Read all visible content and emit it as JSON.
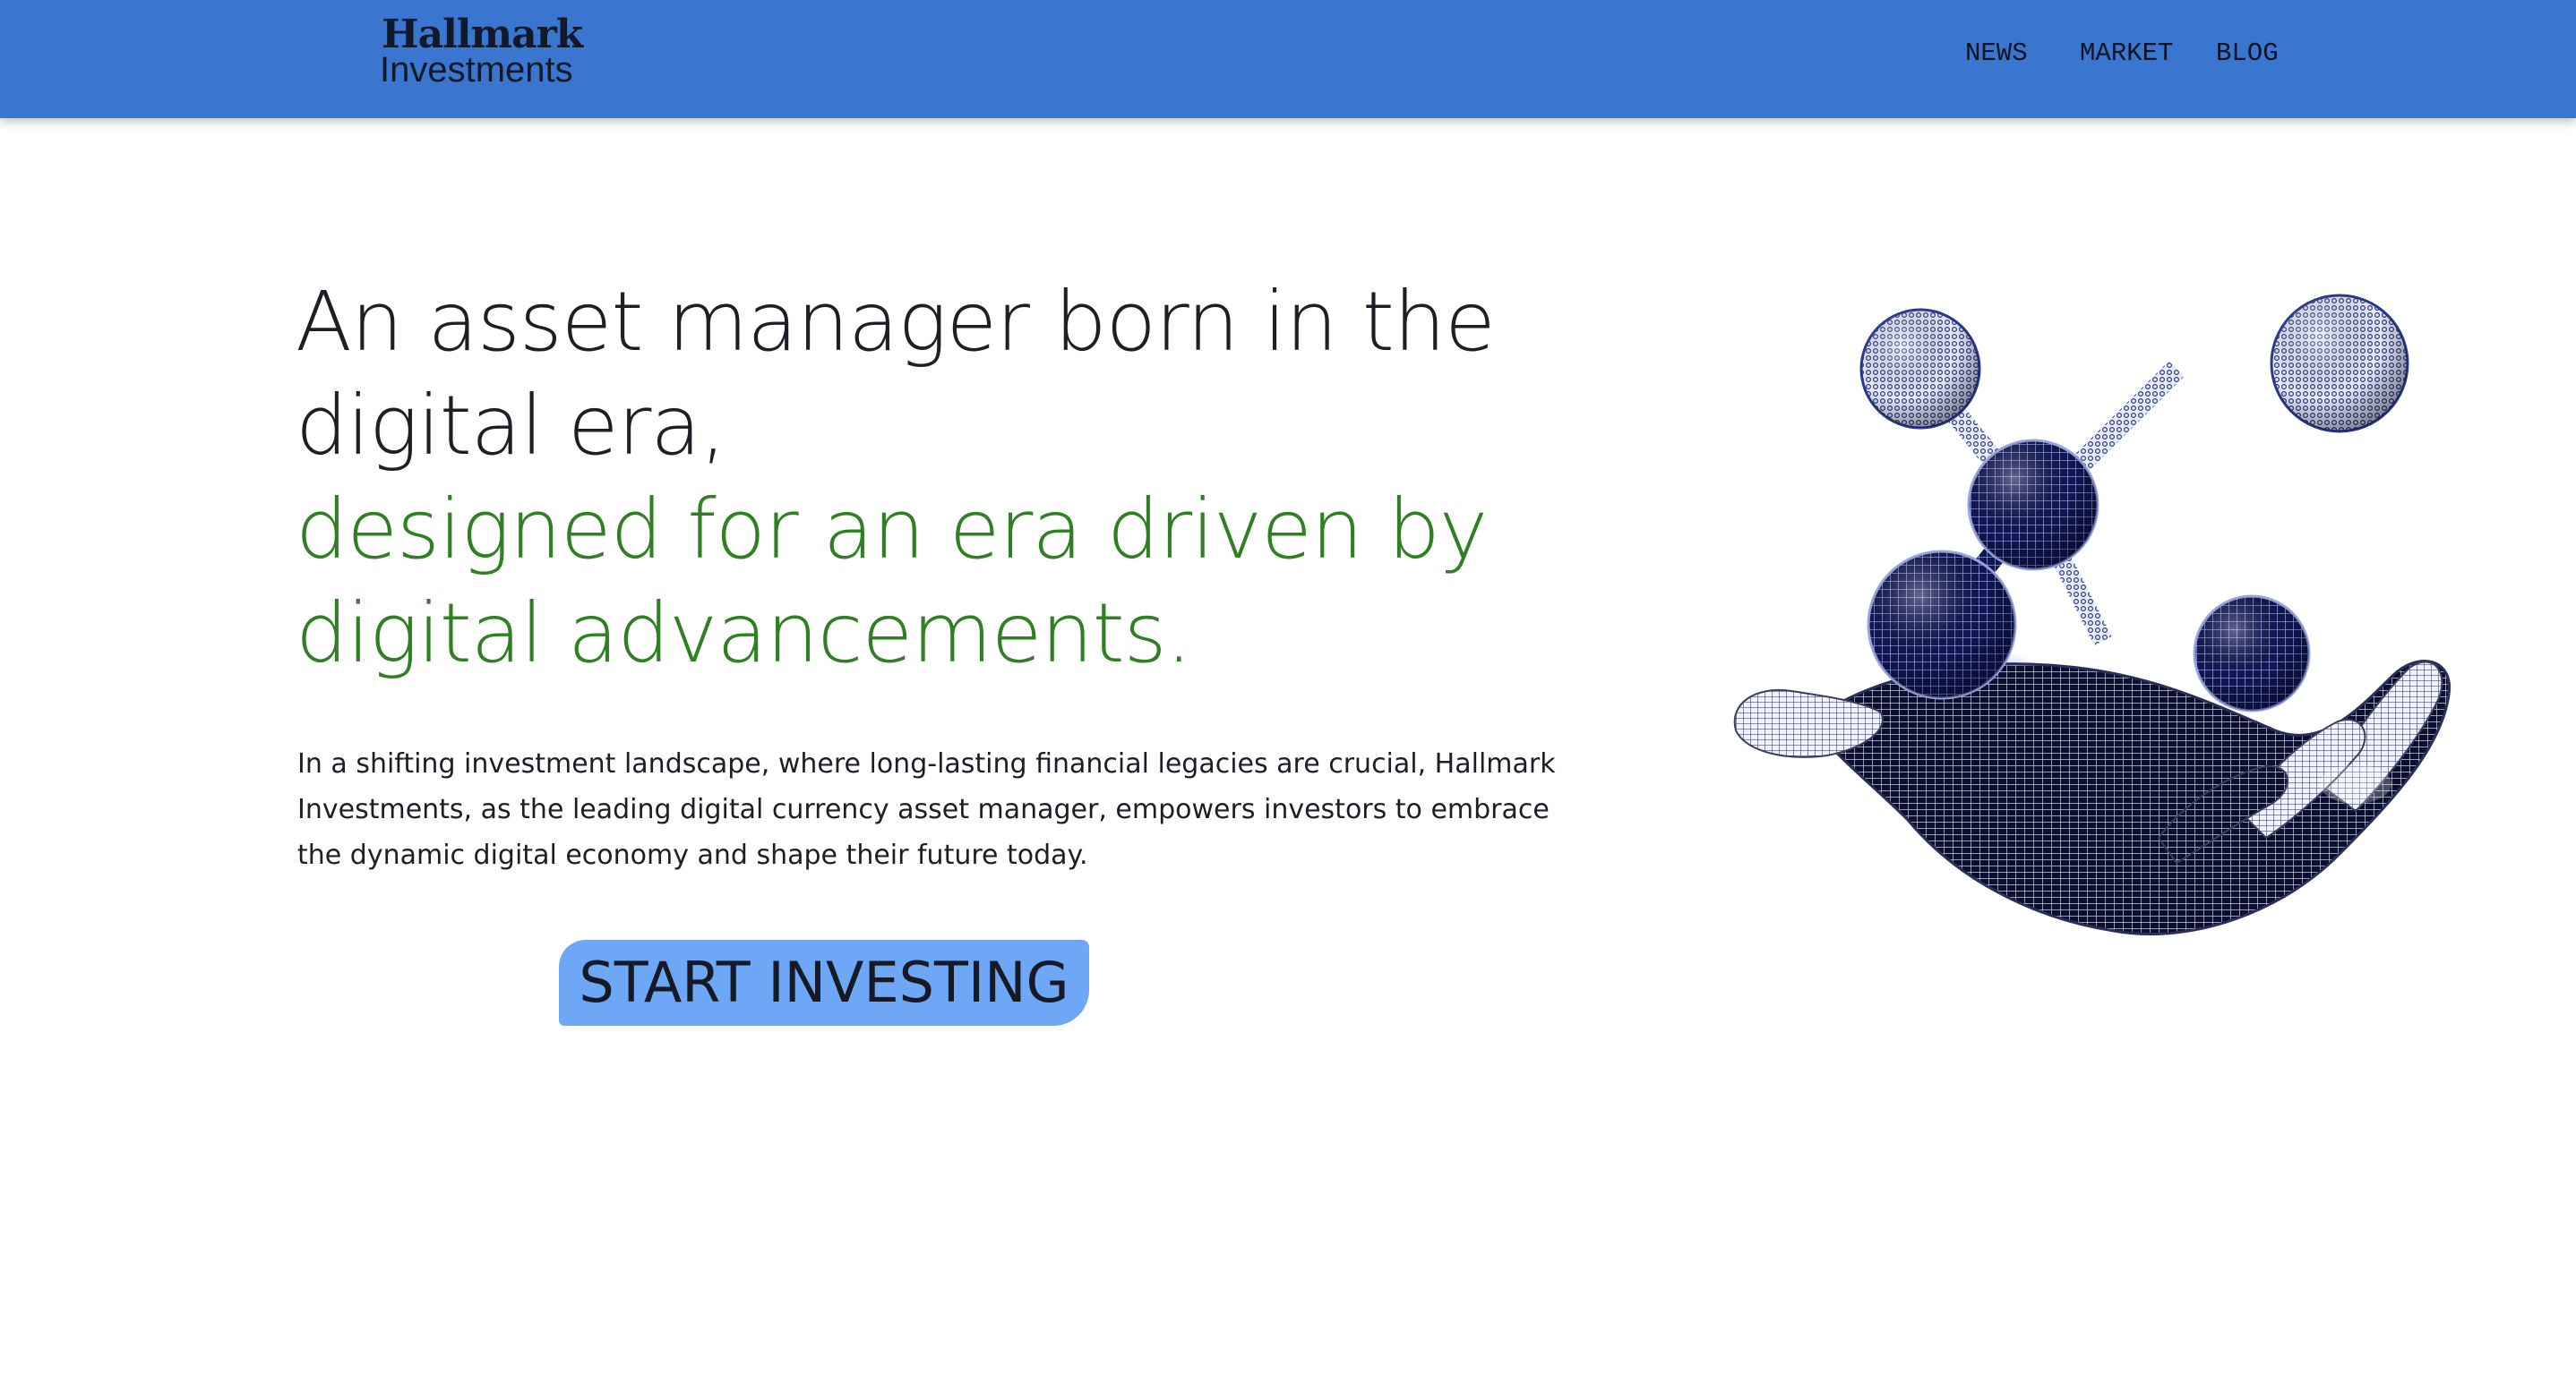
{
  "header": {
    "logo": {
      "line1": "Hallmark",
      "line2": "Investments"
    },
    "nav": [
      {
        "label": "NEWS"
      },
      {
        "label": "MARKET"
      },
      {
        "label": "BLOG"
      }
    ]
  },
  "hero": {
    "headline_lead": "An asset manager born in the digital era,",
    "headline_accent": "designed for an era driven by digital advancements.",
    "intro": "In a shifting investment landscape, where long-lasting financial legacies are crucial, Hallmark Investments, as the leading digital currency asset manager, empowers investors to embrace the dynamic digital economy and shape their future today.",
    "cta_label": "START INVESTING",
    "illustration_icon": "wireframe-hand-holding-molecule-icon"
  },
  "colors": {
    "header_bg": "#3a76cf",
    "accent_text": "#2f8022",
    "cta_bg": "#6ea7f5",
    "text": "#1e1e26",
    "illustration_dark": "#0e1450",
    "illustration_light": "#9aa6e0"
  }
}
